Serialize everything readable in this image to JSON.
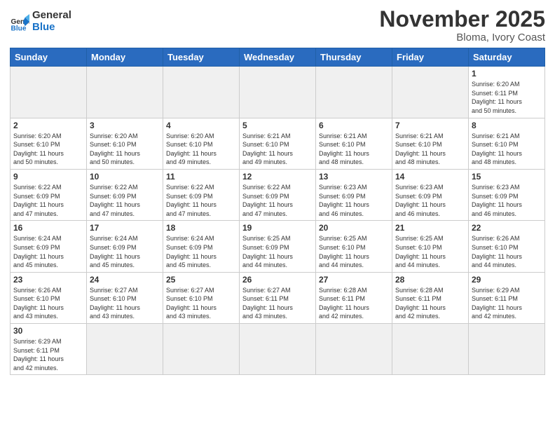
{
  "logo": {
    "text_general": "General",
    "text_blue": "Blue"
  },
  "header": {
    "month": "November 2025",
    "location": "Bloma, Ivory Coast"
  },
  "weekdays": [
    "Sunday",
    "Monday",
    "Tuesday",
    "Wednesday",
    "Thursday",
    "Friday",
    "Saturday"
  ],
  "days": [
    {
      "num": "",
      "info": ""
    },
    {
      "num": "",
      "info": ""
    },
    {
      "num": "",
      "info": ""
    },
    {
      "num": "",
      "info": ""
    },
    {
      "num": "",
      "info": ""
    },
    {
      "num": "",
      "info": ""
    },
    {
      "num": "1",
      "info": "Sunrise: 6:20 AM\nSunset: 6:11 PM\nDaylight: 11 hours\nand 50 minutes."
    },
    {
      "num": "2",
      "info": "Sunrise: 6:20 AM\nSunset: 6:10 PM\nDaylight: 11 hours\nand 50 minutes."
    },
    {
      "num": "3",
      "info": "Sunrise: 6:20 AM\nSunset: 6:10 PM\nDaylight: 11 hours\nand 50 minutes."
    },
    {
      "num": "4",
      "info": "Sunrise: 6:20 AM\nSunset: 6:10 PM\nDaylight: 11 hours\nand 49 minutes."
    },
    {
      "num": "5",
      "info": "Sunrise: 6:21 AM\nSunset: 6:10 PM\nDaylight: 11 hours\nand 49 minutes."
    },
    {
      "num": "6",
      "info": "Sunrise: 6:21 AM\nSunset: 6:10 PM\nDaylight: 11 hours\nand 48 minutes."
    },
    {
      "num": "7",
      "info": "Sunrise: 6:21 AM\nSunset: 6:10 PM\nDaylight: 11 hours\nand 48 minutes."
    },
    {
      "num": "8",
      "info": "Sunrise: 6:21 AM\nSunset: 6:10 PM\nDaylight: 11 hours\nand 48 minutes."
    },
    {
      "num": "9",
      "info": "Sunrise: 6:22 AM\nSunset: 6:09 PM\nDaylight: 11 hours\nand 47 minutes."
    },
    {
      "num": "10",
      "info": "Sunrise: 6:22 AM\nSunset: 6:09 PM\nDaylight: 11 hours\nand 47 minutes."
    },
    {
      "num": "11",
      "info": "Sunrise: 6:22 AM\nSunset: 6:09 PM\nDaylight: 11 hours\nand 47 minutes."
    },
    {
      "num": "12",
      "info": "Sunrise: 6:22 AM\nSunset: 6:09 PM\nDaylight: 11 hours\nand 47 minutes."
    },
    {
      "num": "13",
      "info": "Sunrise: 6:23 AM\nSunset: 6:09 PM\nDaylight: 11 hours\nand 46 minutes."
    },
    {
      "num": "14",
      "info": "Sunrise: 6:23 AM\nSunset: 6:09 PM\nDaylight: 11 hours\nand 46 minutes."
    },
    {
      "num": "15",
      "info": "Sunrise: 6:23 AM\nSunset: 6:09 PM\nDaylight: 11 hours\nand 46 minutes."
    },
    {
      "num": "16",
      "info": "Sunrise: 6:24 AM\nSunset: 6:09 PM\nDaylight: 11 hours\nand 45 minutes."
    },
    {
      "num": "17",
      "info": "Sunrise: 6:24 AM\nSunset: 6:09 PM\nDaylight: 11 hours\nand 45 minutes."
    },
    {
      "num": "18",
      "info": "Sunrise: 6:24 AM\nSunset: 6:09 PM\nDaylight: 11 hours\nand 45 minutes."
    },
    {
      "num": "19",
      "info": "Sunrise: 6:25 AM\nSunset: 6:09 PM\nDaylight: 11 hours\nand 44 minutes."
    },
    {
      "num": "20",
      "info": "Sunrise: 6:25 AM\nSunset: 6:10 PM\nDaylight: 11 hours\nand 44 minutes."
    },
    {
      "num": "21",
      "info": "Sunrise: 6:25 AM\nSunset: 6:10 PM\nDaylight: 11 hours\nand 44 minutes."
    },
    {
      "num": "22",
      "info": "Sunrise: 6:26 AM\nSunset: 6:10 PM\nDaylight: 11 hours\nand 44 minutes."
    },
    {
      "num": "23",
      "info": "Sunrise: 6:26 AM\nSunset: 6:10 PM\nDaylight: 11 hours\nand 43 minutes."
    },
    {
      "num": "24",
      "info": "Sunrise: 6:27 AM\nSunset: 6:10 PM\nDaylight: 11 hours\nand 43 minutes."
    },
    {
      "num": "25",
      "info": "Sunrise: 6:27 AM\nSunset: 6:10 PM\nDaylight: 11 hours\nand 43 minutes."
    },
    {
      "num": "26",
      "info": "Sunrise: 6:27 AM\nSunset: 6:11 PM\nDaylight: 11 hours\nand 43 minutes."
    },
    {
      "num": "27",
      "info": "Sunrise: 6:28 AM\nSunset: 6:11 PM\nDaylight: 11 hours\nand 42 minutes."
    },
    {
      "num": "28",
      "info": "Sunrise: 6:28 AM\nSunset: 6:11 PM\nDaylight: 11 hours\nand 42 minutes."
    },
    {
      "num": "29",
      "info": "Sunrise: 6:29 AM\nSunset: 6:11 PM\nDaylight: 11 hours\nand 42 minutes."
    },
    {
      "num": "30",
      "info": "Sunrise: 6:29 AM\nSunset: 6:11 PM\nDaylight: 11 hours\nand 42 minutes."
    }
  ]
}
